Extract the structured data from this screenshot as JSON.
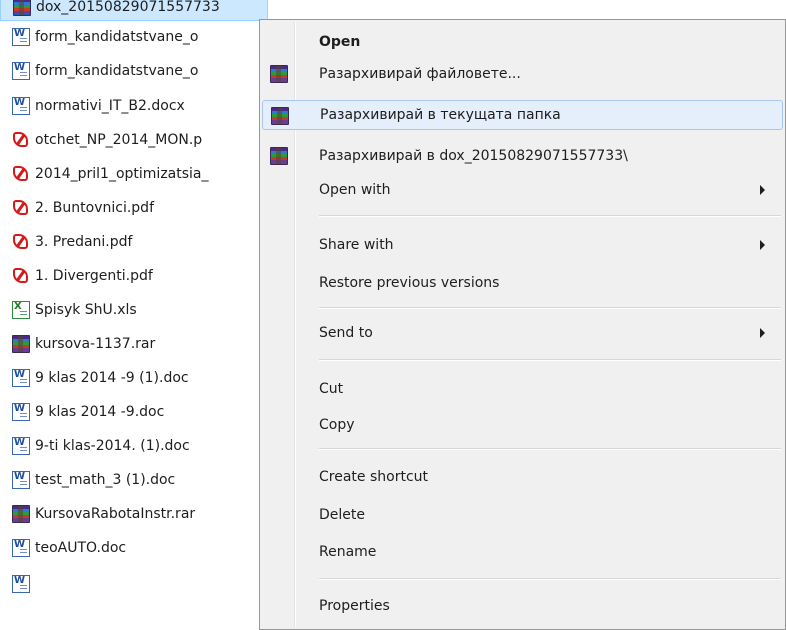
{
  "files": [
    {
      "icon": "rar-icon",
      "name": "dox_20150829071557733",
      "selected": true
    },
    {
      "icon": "word-doc-icon",
      "name": "form_kandidatstvane_o"
    },
    {
      "icon": "word-doc-icon",
      "name": "form_kandidatstvane_o"
    },
    {
      "icon": "word-doc-icon",
      "name": "normativi_IT_B2.docx"
    },
    {
      "icon": "pdf-icon",
      "name": "otchet_NP_2014_MON.p"
    },
    {
      "icon": "pdf-icon",
      "name": "2014_pril1_optimizatsia_"
    },
    {
      "icon": "pdf-icon",
      "name": "2. Buntovnici.pdf"
    },
    {
      "icon": "pdf-icon",
      "name": "3. Predani.pdf"
    },
    {
      "icon": "pdf-icon",
      "name": "1. Divergenti.pdf"
    },
    {
      "icon": "excel-icon",
      "name": "Spisyk ShU.xls"
    },
    {
      "icon": "rar-icon",
      "name": "kursova-1137.rar"
    },
    {
      "icon": "word-doc-icon",
      "name": "9 klas 2014 -9 (1).doc"
    },
    {
      "icon": "word-doc-icon",
      "name": "9 klas 2014 -9.doc"
    },
    {
      "icon": "word-doc-icon",
      "name": "9-ti klas-2014. (1).doc"
    },
    {
      "icon": "word-doc-icon",
      "name": "test_math_3 (1).doc"
    },
    {
      "icon": "rar-icon",
      "name": "KursovaRabotaInstr.rar"
    },
    {
      "icon": "word-doc-icon",
      "name": "teoAUTO.doc"
    }
  ],
  "context_menu": {
    "open": "Open",
    "extract_files": "Разархивирай файловете...",
    "extract_here": "Разархивирай в текущата папка",
    "extract_to": "Разархивирай в dox_20150829071557733\\",
    "open_with": "Open with",
    "share_with": "Share with",
    "restore_previous": "Restore previous versions",
    "send_to": "Send to",
    "cut": "Cut",
    "copy": "Copy",
    "create_shortcut": "Create shortcut",
    "delete": "Delete",
    "rename": "Rename",
    "properties": "Properties"
  },
  "colors": {
    "selection": "#cce8ff",
    "menu_background": "#f0f0f0",
    "menu_hover": "#e5eefb",
    "pdf_red": "#d11b1b",
    "word_blue": "#3a66b6"
  }
}
